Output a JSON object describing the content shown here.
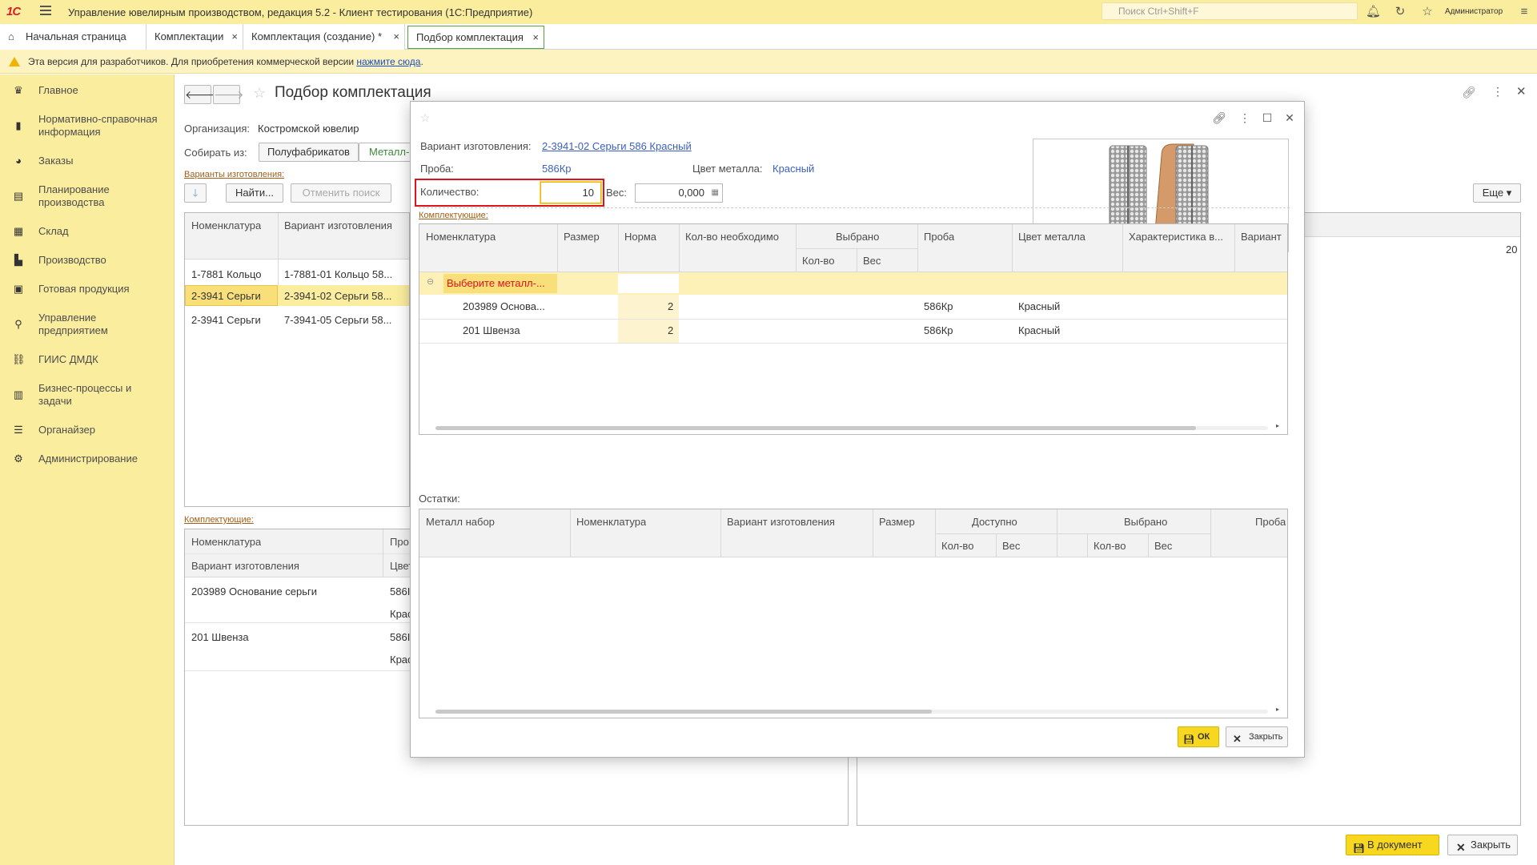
{
  "app": {
    "logo": "1С",
    "title": "Управление ювелирным производством, редакция 5.2  - Клиент тестирования (1С:Предприятие)",
    "search_placeholder": "Поиск Ctrl+Shift+F",
    "user": "Администратор"
  },
  "tabs": [
    {
      "label": "Начальная страница"
    },
    {
      "label": "Комплектации"
    },
    {
      "label": "Комплектация (создание) *"
    },
    {
      "label": "Подбор комплектация"
    }
  ],
  "warning": {
    "text": "Эта версия для разработчиков. Для приобретения коммерческой версии ",
    "link": "нажмите сюда",
    "tail": "."
  },
  "sidebar": {
    "items": [
      {
        "label": "Главное",
        "icon": "crown-icon"
      },
      {
        "label": "Нормативно-справочная информация",
        "icon": "book-icon"
      },
      {
        "label": "Заказы",
        "icon": "pie-icon"
      },
      {
        "label": "Планирование производства",
        "icon": "clipboard-icon"
      },
      {
        "label": "Склад",
        "icon": "grid-icon"
      },
      {
        "label": "Производство",
        "icon": "factory-icon"
      },
      {
        "label": "Готовая продукция",
        "icon": "bag-icon"
      },
      {
        "label": "Управление предприятием",
        "icon": "org-icon"
      },
      {
        "label": "ГИИС ДМДК",
        "icon": "link-icon"
      },
      {
        "label": "Бизнес-процессы и задачи",
        "icon": "tasks-icon"
      },
      {
        "label": "Органайзер",
        "icon": "sliders-icon"
      },
      {
        "label": "Администрирование",
        "icon": "gear-icon"
      }
    ]
  },
  "main": {
    "title": "Подбор комплектация",
    "org_label": "Организация:",
    "org_value": "Костромской ювелир",
    "collect_label": "Собирать из:",
    "collect_tabs": [
      "Полуфабрикатов",
      "Металл-"
    ],
    "variants_link": "Варианты изготовления:",
    "find_btn": "Найти...",
    "cancel_search_btn": "Отменить поиск",
    "more_btn": "Еще",
    "variants_grid": {
      "headers": [
        "Номенклатура",
        "Вариант изготовления"
      ],
      "rows": [
        [
          "1-7881 Кольцо",
          "1-7881-01 Кольцо 58..."
        ],
        [
          "2-3941 Серьги",
          "2-3941-02 Серьги 58..."
        ],
        [
          "2-3941 Серьги",
          "7-3941-05 Серьги 58..."
        ]
      ]
    },
    "right_value": "20",
    "components_link": "Комплектующие:",
    "components_grid": {
      "headers": [
        "Номенклатура",
        "Про",
        "Вариант изготовления",
        "Цвет"
      ],
      "rows": [
        [
          "203989 Основание серьги",
          "586I",
          "Крас"
        ],
        [
          "201 Швенза",
          "586I",
          "Крас"
        ]
      ]
    },
    "to_doc_btn": "В документ",
    "close_btn": "Закрыть"
  },
  "dialog": {
    "variant_label": "Вариант изготовления:",
    "variant_value": "2-3941-02 Серьги 586 Красный",
    "proba_label": "Проба:",
    "proba_value": "586Кр",
    "color_label": "Цвет металла:",
    "color_value": "Красный",
    "qty_label": "Количество:",
    "qty_value": "10",
    "weight_label": "Вес:",
    "weight_value": "0,000",
    "components_link": "Комплектующие:",
    "comp_grid": {
      "headers": [
        "Номенклатура",
        "Размер",
        "Норма",
        "Кол-во  необходимо",
        "Выбрано",
        "Кол-во",
        "Вес",
        "Проба",
        "Цвет металла",
        "Характеристика в...",
        "Вариант"
      ],
      "group_row": "Выберите металл-...",
      "rows": [
        {
          "name": "203989 Основа...",
          "norm": "2",
          "proba": "586Кр",
          "color": "Красный"
        },
        {
          "name": "201 Швенза",
          "norm": "2",
          "proba": "586Кр",
          "color": "Красный"
        }
      ]
    },
    "rest_label": "Остатки:",
    "rest_grid": {
      "headers": [
        "Металл набор",
        "Номенклатура",
        "Вариант изготовления",
        "Размер",
        "Доступно",
        "Кол-во",
        "Вес",
        "Выбрано",
        "Кол-во",
        "Вес",
        "Проба"
      ]
    },
    "ok_btn": "ОК",
    "close_btn": "Закрыть"
  },
  "colors": {
    "accent_yellow": "#fbed9e",
    "button_yellow": "#f8d71f",
    "highlight_red": "#e0121a",
    "link_blue": "#3a5fbf"
  }
}
